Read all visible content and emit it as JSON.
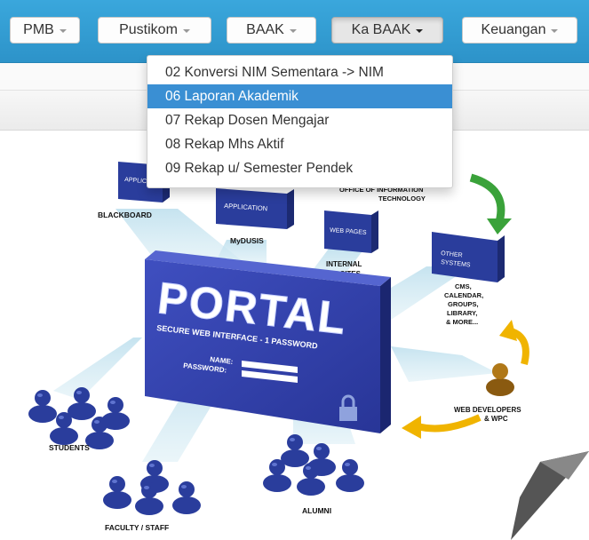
{
  "nav": {
    "buttons": [
      {
        "label": "PMB"
      },
      {
        "label": "Pustikom"
      },
      {
        "label": "BAAK"
      },
      {
        "label": "Ka BAAK"
      },
      {
        "label": "Keuangan"
      }
    ]
  },
  "dropdown": {
    "items": [
      {
        "label": "02 Konversi NIM Sementara -> NIM"
      },
      {
        "label": "06 Laporan Akademik"
      },
      {
        "label": "07 Rekap Dosen Mengajar"
      },
      {
        "label": "08 Rekap Mhs Aktif"
      },
      {
        "label": "09 Rekap u/ Semester Pendek"
      }
    ],
    "highlighted": "06 Laporan Akademik"
  },
  "illustration": {
    "portal": "PORTAL",
    "portal_sub": "SECURE WEB INTERFACE - 1 PASSWORD",
    "name_label": "NAME:",
    "password_label": "PASSWORD:",
    "application": "APPLICATION",
    "web_pages": "WEB PAGES",
    "other_line1": "OTHER",
    "other_line2": "SYSTEMS",
    "blackboard": "BLACKBOARD",
    "mydusis": "MyDUSIS",
    "internal_line1": "INTERNAL",
    "internal_line2": "WEB SITES",
    "oit_line1": "OFFICE OF INFORMATION",
    "oit_line2": "TECHNOLOGY",
    "cms_lines": [
      "CMS,",
      "CALENDAR,",
      "GROUPS,",
      "LIBRARY,",
      "& MORE..."
    ],
    "web_dev_line1": "WEB DEVELOPERS",
    "web_dev_line2": "& WPC",
    "students": "STUDENTS",
    "faculty": "FACULTY / STAFF",
    "alumni": "ALUMNI",
    "accent_blue": "#2a3d9c",
    "arrow_green": "#3aa23a",
    "arrow_yellow": "#f0b400"
  }
}
